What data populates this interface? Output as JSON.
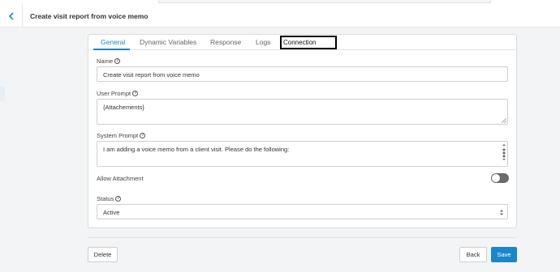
{
  "header": {
    "title": "Create visit report from voice memo"
  },
  "tabs": [
    {
      "label": "General",
      "active": true
    },
    {
      "label": "Dynamic Variables",
      "active": false
    },
    {
      "label": "Response",
      "active": false
    },
    {
      "label": "Logs",
      "active": false
    },
    {
      "label": "Connection",
      "active": false,
      "highlighted": true
    }
  ],
  "form": {
    "name": {
      "label": "Name",
      "value": "Create visit report from voice memo"
    },
    "user_prompt": {
      "label": "User Prompt",
      "value": "{Attachements}"
    },
    "system_prompt": {
      "label": "System Prompt",
      "value": "I am adding a voice memo from a client visit. Please do the following:"
    },
    "allow_attachment": {
      "label": "Allow Attachment",
      "enabled": false
    },
    "status": {
      "label": "Status",
      "value": "Active"
    }
  },
  "buttons": {
    "delete": "Delete",
    "back": "Back",
    "save": "Save"
  },
  "colors": {
    "accent": "#1a87c9",
    "toggle_off": "#6b6b6b"
  },
  "icons": [
    "chevron-left-icon",
    "help-icon",
    "resize-handle-icon",
    "scroll-dots-icon",
    "select-arrows-icon"
  ]
}
